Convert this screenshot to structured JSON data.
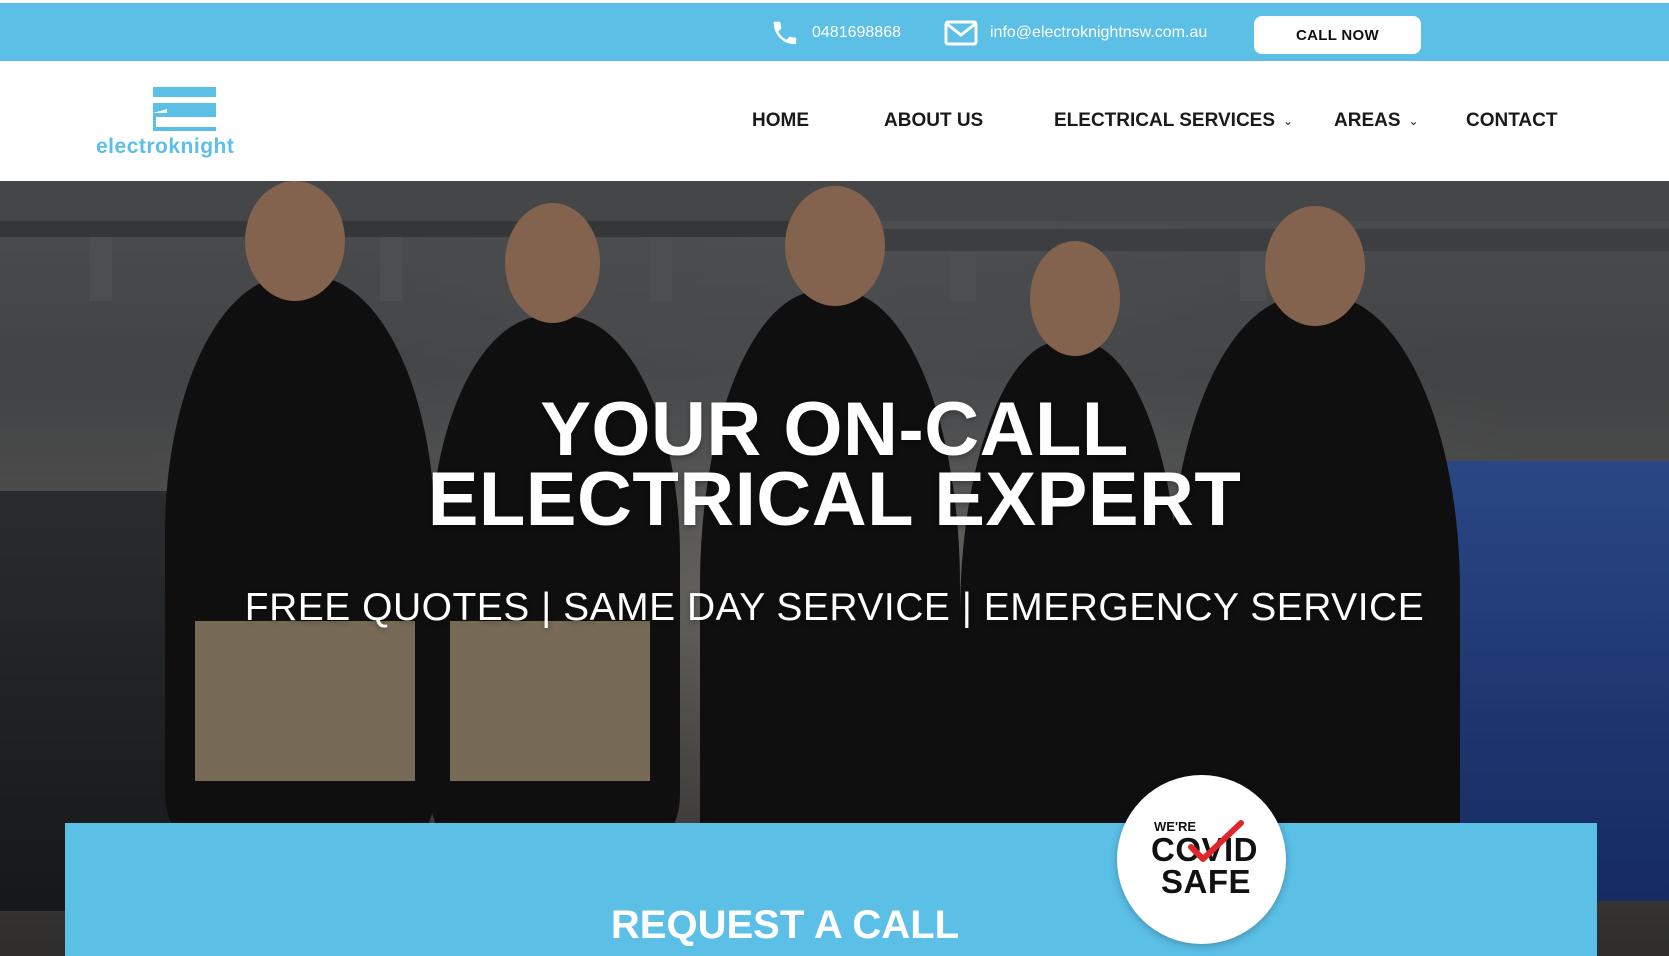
{
  "topbar": {
    "phone": "0481698868",
    "email": "info@electroknightnsw.com.au",
    "call_button": "CALL NOW",
    "icons": {
      "phone": "phone-icon",
      "email": "envelope-icon"
    }
  },
  "header": {
    "logo_text": "electroknight",
    "nav": [
      {
        "label": "HOME",
        "has_dropdown": false
      },
      {
        "label": "ABOUT US",
        "has_dropdown": false
      },
      {
        "label": "ELECTRICAL SERVICES",
        "has_dropdown": true
      },
      {
        "label": "AREAS",
        "has_dropdown": true
      },
      {
        "label": "CONTACT",
        "has_dropdown": false
      }
    ],
    "dropdown_glyph": "⌄"
  },
  "hero": {
    "title_line1": "YOUR ON-CALL",
    "title_line2": "ELECTRICAL EXPERT",
    "subtitle": "FREE QUOTES | SAME DAY SERVICE | EMERGENCY SERVICE"
  },
  "request": {
    "title": "REQUEST A CALL"
  },
  "badge": {
    "line1": "WE'RE",
    "line2": "COVID",
    "line3": "SAFE"
  },
  "colors": {
    "brand_blue": "#5bbfe6",
    "white": "#ffffff",
    "text_dark": "#1a1a1a",
    "check_red": "#e0262c"
  }
}
